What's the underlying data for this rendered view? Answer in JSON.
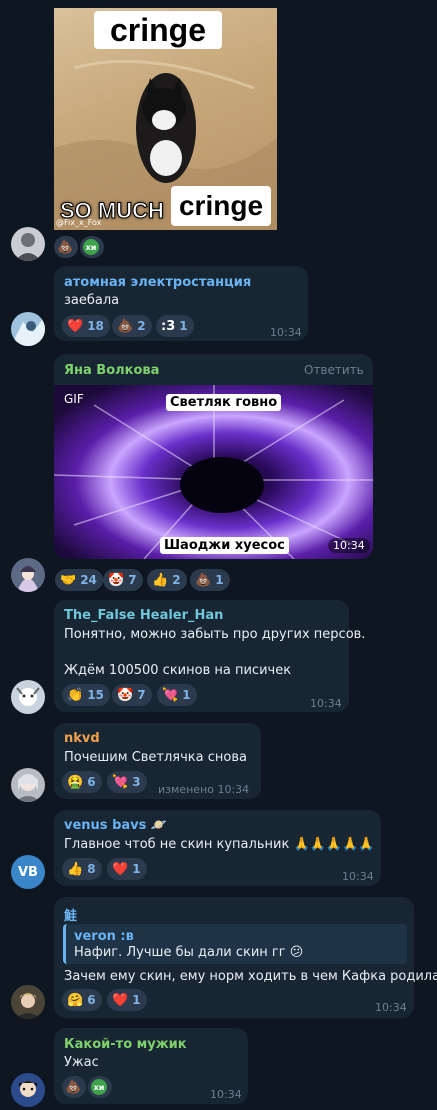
{
  "messages": {
    "m1": {
      "image_caption_top": "cringe",
      "image_caption_bottom_left": "SO MUCH",
      "image_caption_bottom_right": "cringe",
      "image_watermark": "@Fix_x_Fox",
      "reactions": [
        {
          "emoji": "💩",
          "count": ""
        },
        {
          "emoji": "xi",
          "count": ""
        }
      ]
    },
    "m2": {
      "author": "атомная электростанция",
      "text": "заебала",
      "time": "10:34",
      "reactions": [
        {
          "emoji": "❤️",
          "count": "18"
        },
        {
          "emoji": "💩",
          "count": "2"
        },
        {
          "emoji": ":3",
          "count": "1"
        }
      ]
    },
    "m3": {
      "author": "Яна Волкова",
      "reply_label": "Ответить",
      "gif_badge": "GIF",
      "gif_caption_top": "Светляк говно",
      "gif_caption_bottom": "Шаоджи хуесос",
      "time": "10:34",
      "reactions": [
        {
          "emoji": "🤝",
          "count": "24"
        },
        {
          "emoji": "🤡",
          "count": "7"
        },
        {
          "emoji": "👍",
          "count": "2"
        },
        {
          "emoji": "💩",
          "count": "1"
        }
      ]
    },
    "m4": {
      "author": "The_False Healer_Han",
      "line1": "Понятно, можно забыть про других персов.",
      "line2": "Ждём 100500 скинов на писичек",
      "time": "10:34",
      "reactions": [
        {
          "emoji": "👏",
          "count": "15"
        },
        {
          "emoji": "🤡",
          "count": "7"
        },
        {
          "emoji": "💘",
          "count": "1"
        }
      ]
    },
    "m5": {
      "author": "nkvd",
      "text": "Почешим Светлячка снова",
      "time": "изменено 10:34",
      "reactions": [
        {
          "emoji": "🤮",
          "count": "6"
        },
        {
          "emoji": "💘",
          "count": "3"
        }
      ]
    },
    "m6": {
      "author": "venus bavs",
      "author_emoji": "🪐",
      "avatar_initials": "VB",
      "text": "Главное чтоб не скин купальник",
      "text_emoji": "🙏🙏🙏🙏🙏",
      "time": "10:34",
      "reactions": [
        {
          "emoji": "👍",
          "count": "8"
        },
        {
          "emoji": "❤️",
          "count": "1"
        }
      ]
    },
    "m7": {
      "author": "鮭",
      "quote_author": "veron :в",
      "quote_text": "Нафиг. Лучше бы дали скин гг",
      "quote_emoji": "😕",
      "text": "Зачем ему скин, ему норм ходить в чем Кафка родила",
      "time": "10:34",
      "reactions": [
        {
          "emoji": "🤗",
          "count": "6"
        },
        {
          "emoji": "❤️",
          "count": "1"
        }
      ]
    },
    "m8": {
      "author": "Какой-то мужик",
      "text": "Ужас",
      "time": "10:34",
      "reactions": [
        {
          "emoji": "💩",
          "count": ""
        },
        {
          "emoji": "xi",
          "count": ""
        }
      ]
    }
  },
  "colors": {
    "background": "#0e1621",
    "bubble": "#182533",
    "chip": "#2b3a4c",
    "name_blue": "#6ab3f3",
    "name_green": "#7fd26b",
    "name_cyan": "#6fc7d9",
    "name_orange": "#f0a24a"
  }
}
